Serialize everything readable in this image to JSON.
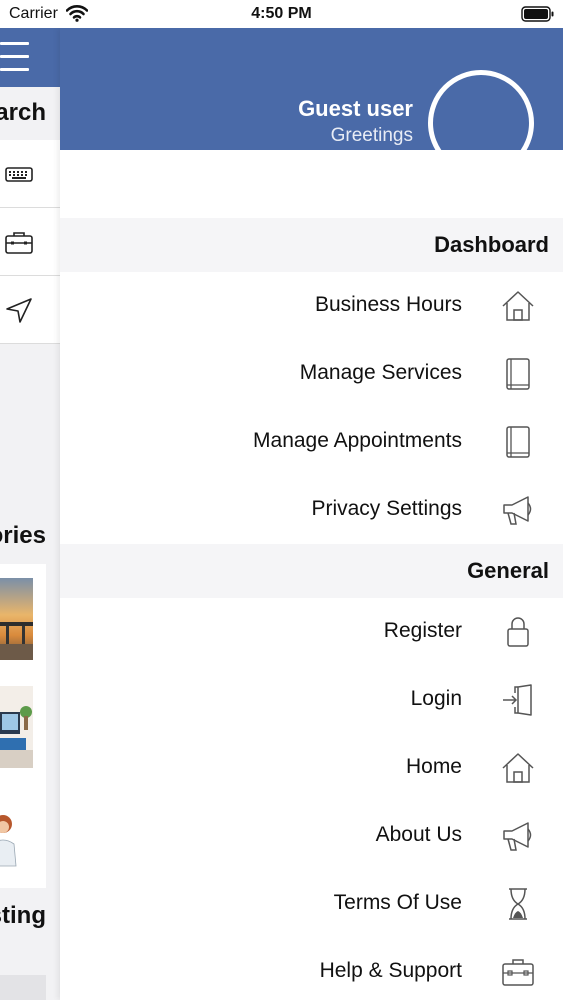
{
  "status_bar": {
    "carrier": "Carrier",
    "time": "4:50 PM"
  },
  "background": {
    "search_title": "arch",
    "categories_title": "ories",
    "listing_title": "sting",
    "row_icons": [
      "keyboard-icon",
      "briefcase-icon",
      "location-arrow-icon"
    ]
  },
  "drawer": {
    "user": {
      "name": "Guest user",
      "greeting": "Greetings"
    },
    "sections": [
      {
        "title": "Dashboard",
        "items": [
          {
            "label": "Business Hours",
            "icon": "home-icon"
          },
          {
            "label": "Manage Services",
            "icon": "book-icon"
          },
          {
            "label": "Manage Appointments",
            "icon": "book-icon"
          },
          {
            "label": "Privacy Settings",
            "icon": "megaphone-icon"
          }
        ]
      },
      {
        "title": "General",
        "items": [
          {
            "label": "Register",
            "icon": "lock-icon"
          },
          {
            "label": "Login",
            "icon": "login-door-icon"
          },
          {
            "label": "Home",
            "icon": "home-icon"
          },
          {
            "label": "About Us",
            "icon": "megaphone-icon"
          },
          {
            "label": "Terms Of Use",
            "icon": "hourglass-icon"
          },
          {
            "label": "Help & Support",
            "icon": "briefcase-icon"
          }
        ]
      }
    ]
  },
  "colors": {
    "header_blue": "#4a6aa8",
    "section_bg": "#f5f5f7"
  }
}
